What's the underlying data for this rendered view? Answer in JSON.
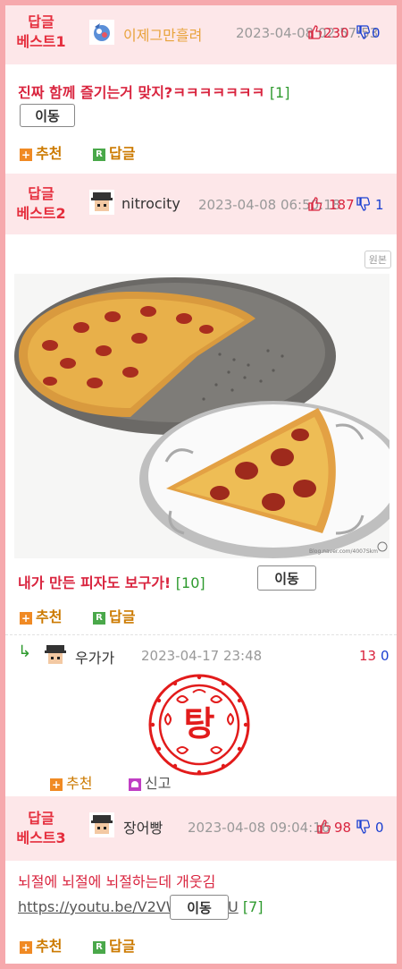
{
  "best1": {
    "badge": "답글\n베스트1",
    "badge_line1": "답글",
    "badge_line2": "베스트1",
    "nick": "이제그만흘려",
    "date": "2023-04-08 02:57:53",
    "up": "230",
    "down": "0",
    "title": "진짜 함께 즐기는거 맞지?ㅋㅋㅋㅋㅋㅋㅋ",
    "comment_count": "[1]",
    "move_label": "이동",
    "recommend_label": "추천",
    "reply_label": "답글"
  },
  "best2": {
    "badge_line1": "답글",
    "badge_line2": "베스트2",
    "nick": "nitrocity",
    "date": "2023-04-08 06:50:18",
    "up": "187",
    "down": "1",
    "original_label": "원본",
    "image_watermark": "Blog.naver.com/4007Skm",
    "title": "내가 만든 피자도 보구가!",
    "comment_count": "[10]",
    "move_label": "이동",
    "recommend_label": "추천",
    "reply_label": "답글"
  },
  "reply": {
    "arrow": "↳",
    "nick": "우가가",
    "date": "2023-04-17 23:48",
    "up": "13",
    "down": "0",
    "stamp_text": "탕",
    "recommend_label": "추천",
    "report_label": "신고"
  },
  "best3": {
    "badge_line1": "답글",
    "badge_line2": "베스트3",
    "nick": "장어빵",
    "date": "2023-04-08 09:04:16",
    "up": "98",
    "down": "0",
    "title_text": "뇌절에 뇌절에 뇌절하는데 개웃김 ",
    "link_text": "https://youtu.be/V2VW4oEFTIU",
    "comment_count": "[7]",
    "move_label": "이동",
    "recommend_label": "추천",
    "reply_label": "답글"
  },
  "colors": {
    "border": "#f6a9ad",
    "header_bg": "#fde7e9",
    "accent_red": "#e52e3d",
    "down_blue": "#1a3fd1",
    "count_green": "#2e9a2e",
    "action_orange": "#cc7a00"
  },
  "icons": {
    "thumb_up": "thumb-up-icon",
    "thumb_down": "thumb-down-icon",
    "plus": "plus-icon",
    "reply": "reply-r-icon",
    "report": "report-icon"
  }
}
